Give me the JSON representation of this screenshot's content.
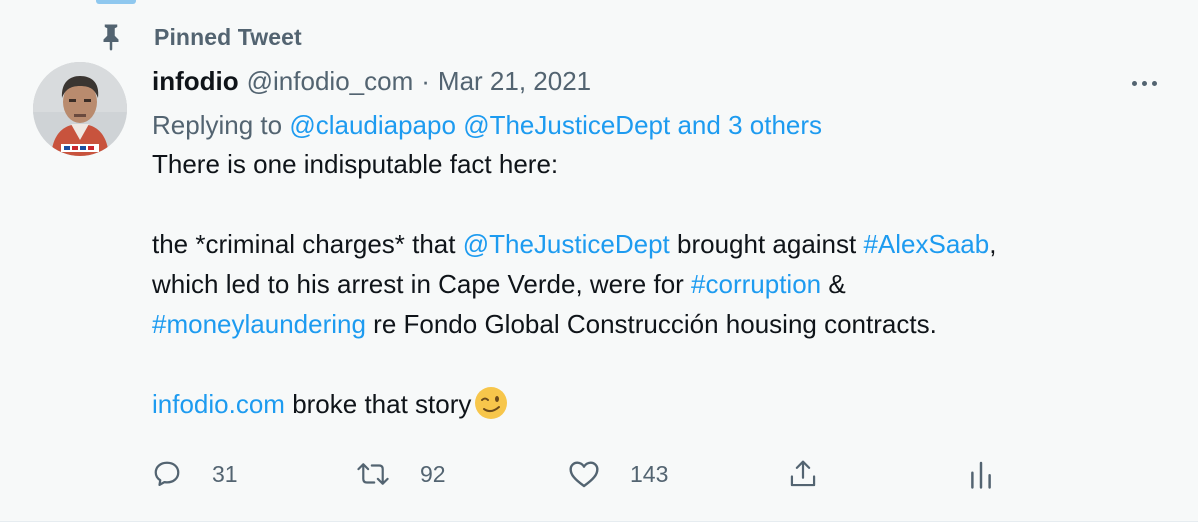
{
  "pinned": {
    "label": "Pinned Tweet"
  },
  "author": {
    "name": "infodio",
    "handle": "@infodio_com",
    "separator": "·",
    "date": "Mar 21, 2021"
  },
  "reply": {
    "prefix": "Replying to",
    "mention1": "@claudiapapo",
    "mention2": "@TheJusticeDept",
    "others": "and 3 others"
  },
  "body": {
    "line1": "There is one indisputable fact here:",
    "p2_a": "the *criminal charges* that ",
    "p2_mention": "@TheJusticeDept",
    "p2_b": " brought against ",
    "p2_tag1": "#AlexSaab",
    "p2_c": ",",
    "p2_d": "which led to his arrest in Cape Verde, were for ",
    "p2_tag2": "#corruption",
    "p2_e": " &",
    "p2_tag3": "#moneylaundering",
    "p2_f": " re Fondo Global Construcción housing contracts.",
    "p3_link": "infodio.com",
    "p3_text": " broke that story"
  },
  "actions": {
    "replies": "31",
    "retweets": "92",
    "likes": "143"
  },
  "colors": {
    "accent": "#1d9bf0",
    "secondary_text": "#536471",
    "background": "#f7f9f9"
  },
  "icons": [
    "pin-icon",
    "more-icon",
    "reply-icon",
    "retweet-icon",
    "like-icon",
    "share-icon",
    "analytics-icon",
    "wink-emoji"
  ]
}
